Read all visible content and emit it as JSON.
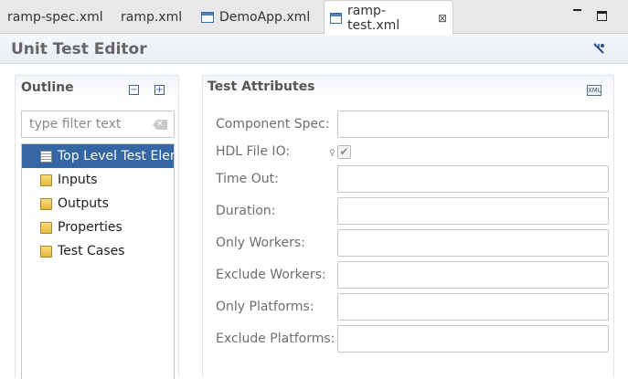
{
  "tabs": [
    {
      "label": "ramp-spec.xml",
      "icon": "xml-file-icon"
    },
    {
      "label": "ramp.xml",
      "icon": "xml-file-icon"
    },
    {
      "label": "DemoApp.xml",
      "icon": "editor-file-icon"
    },
    {
      "label": "ramp-test.xml",
      "icon": "editor-file-icon",
      "active": true,
      "close": "⊠"
    }
  ],
  "window_controls": {
    "minimize": "minimize-icon",
    "maximize": "maximize-icon"
  },
  "editor": {
    "title": "Unit Test Editor"
  },
  "outline": {
    "title": "Outline",
    "collapse_all": "−",
    "expand_all": "+",
    "filter_placeholder": "type filter text",
    "filter_value": "",
    "clear_glyph": "✕",
    "items": [
      {
        "label": "Top Level Test Element",
        "icon": "document-icon",
        "selected": true
      },
      {
        "label": "Inputs",
        "icon": "folder-icon"
      },
      {
        "label": "Outputs",
        "icon": "folder-icon"
      },
      {
        "label": "Properties",
        "icon": "folder-icon"
      },
      {
        "label": "Test Cases",
        "icon": "folder-icon"
      }
    ]
  },
  "attributes": {
    "title": "Test Attributes",
    "tool_glyph": "XML",
    "fields": {
      "component_spec": {
        "label": "Component Spec:",
        "value": ""
      },
      "hdl_file_io": {
        "label": "HDL File IO:",
        "checked": true,
        "check_glyph": "✔",
        "hint_glyph": "♀"
      },
      "time_out": {
        "label": "Time Out:",
        "value": ""
      },
      "duration": {
        "label": "Duration:",
        "value": ""
      },
      "only_workers": {
        "label": "Only Workers:",
        "value": ""
      },
      "exclude_workers": {
        "label": "Exclude Workers:",
        "value": ""
      },
      "only_platforms": {
        "label": "Only Platforms:",
        "value": ""
      },
      "exclude_platforms": {
        "label": "Exclude Platforms:",
        "value": ""
      }
    }
  },
  "colors": {
    "selection": "#3465a4",
    "header_gradient_top": "#f3f6fa",
    "label_gray": "#6e6e6e"
  }
}
